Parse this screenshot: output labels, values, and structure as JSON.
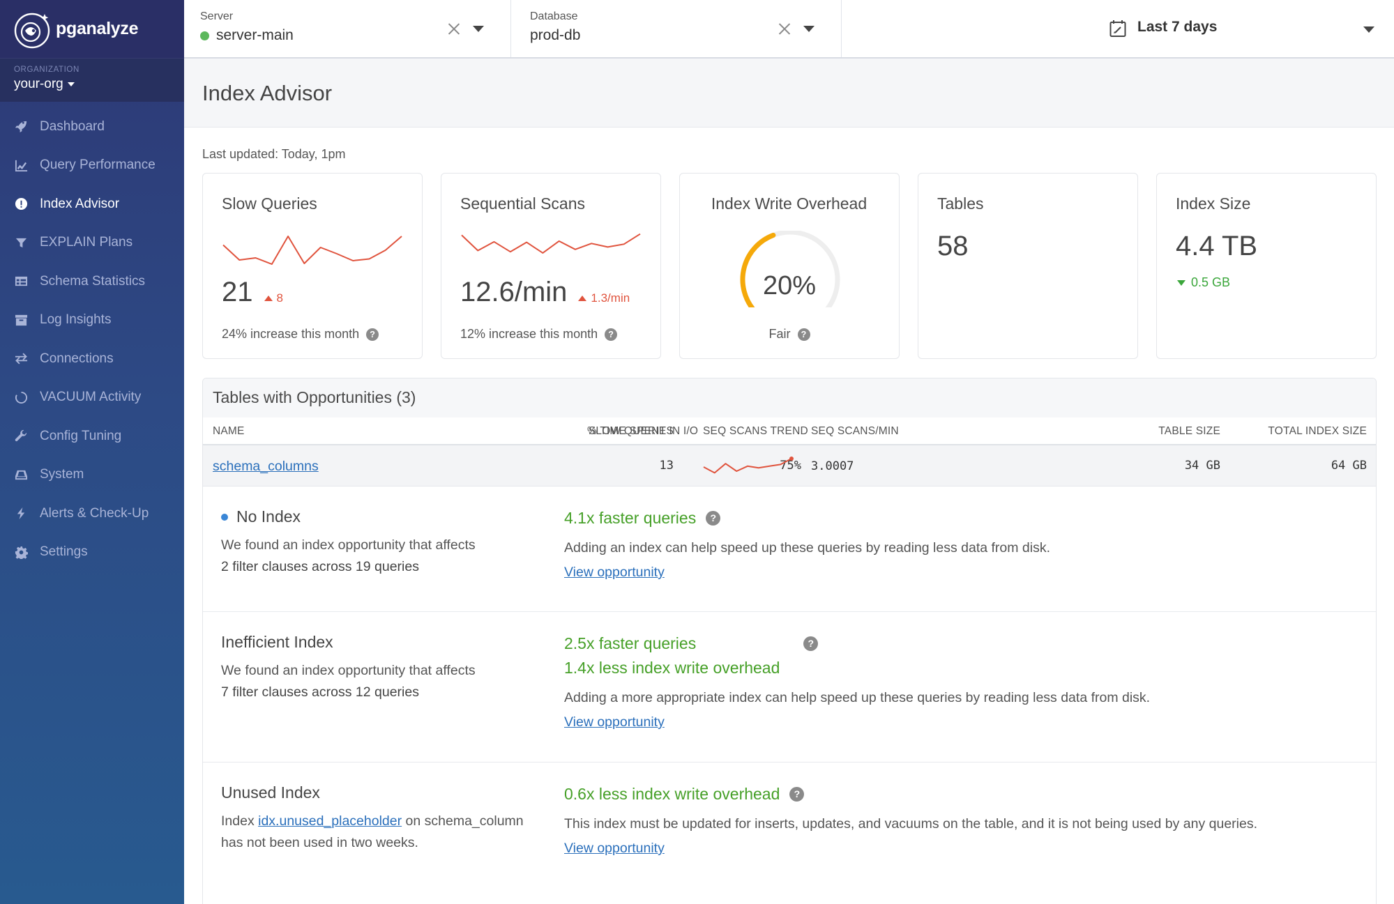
{
  "brand": {
    "name": "pganalyze"
  },
  "org": {
    "label": "ORGANIZATION",
    "name": "your-org"
  },
  "nav": [
    {
      "label": "Dashboard",
      "icon": "rocket-icon"
    },
    {
      "label": "Query Performance",
      "icon": "line-chart-icon"
    },
    {
      "label": "Index Advisor",
      "icon": "exclamation-circle-icon",
      "active": true
    },
    {
      "label": "EXPLAIN Plans",
      "icon": "filter-icon"
    },
    {
      "label": "Schema Statistics",
      "icon": "table-icon"
    },
    {
      "label": "Log Insights",
      "icon": "archive-icon"
    },
    {
      "label": "Connections",
      "icon": "exchange-icon"
    },
    {
      "label": "VACUUM Activity",
      "icon": "circle-notch-icon"
    },
    {
      "label": "Config Tuning",
      "icon": "wrench-icon"
    },
    {
      "label": "System",
      "icon": "hdd-icon"
    },
    {
      "label": "Alerts & Check-Up",
      "icon": "bolt-icon"
    },
    {
      "label": "Settings",
      "icon": "gear-icon"
    }
  ],
  "topbar": {
    "server": {
      "label": "Server",
      "value": "server-main",
      "status_color": "#5cb85c"
    },
    "database": {
      "label": "Database",
      "value": "prod-db"
    },
    "date_range": "Last 7 days"
  },
  "page": {
    "title": "Index Advisor",
    "last_updated": "Last updated: Today, 1pm"
  },
  "cards": {
    "slow_queries": {
      "title": "Slow Queries",
      "value": "21",
      "delta": "8",
      "footnote": "24% increase this month",
      "spark": [
        0.35,
        0.78,
        0.72,
        0.9,
        0.1,
        0.88,
        0.42,
        0.6,
        0.8,
        0.75,
        0.5,
        0.1
      ]
    },
    "seq_scans": {
      "title": "Sequential Scans",
      "value": "12.6/min",
      "delta": "1.3/min",
      "footnote": "12% increase this month",
      "spark": [
        0.1,
        0.75,
        0.38,
        0.8,
        0.4,
        0.85,
        0.35,
        0.7,
        0.45,
        0.6,
        0.48,
        0.05
      ]
    },
    "write_overhead": {
      "title": "Index Write Overhead",
      "value": "20%",
      "gauge_fraction": 0.2,
      "rating": "Fair",
      "gauge_color": "#f5a90a"
    },
    "tables": {
      "title": "Tables",
      "value": "58"
    },
    "index_size": {
      "title": "Index Size",
      "value": "4.4 TB",
      "delta": "0.5 GB"
    }
  },
  "opportunities": {
    "title": "Tables with Opportunities (3)",
    "columns": [
      "NAME",
      "SLOW QUERIES",
      "% TIME SPENT IN I/O",
      "SEQ SCANS TREND",
      "SEQ SCANS/MIN",
      "TABLE SIZE",
      "TOTAL INDEX SIZE"
    ],
    "row": {
      "name": "schema_columns",
      "slow_queries": "13",
      "io_pct": "75%",
      "trend": [
        0.5,
        0.85,
        0.3,
        0.75,
        0.45,
        0.55,
        0.45,
        0.35,
        0.0
      ],
      "seq_scans_min": "3.0007",
      "table_size": "34 GB",
      "total_index_size": "64 GB"
    },
    "items": [
      {
        "type": "No Index",
        "desc_line1": "We found an index opportunity that affects",
        "desc_line2": "2 filter clauses across 19 queries",
        "gain1": "4.1x faster queries",
        "text": "Adding an index can help speed up these queries by reading less data from disk.",
        "link": "View opportunity"
      },
      {
        "type": "Inefficient Index",
        "desc_line1": "We found an index opportunity that affects",
        "desc_line2": "7 filter clauses across 12 queries",
        "gain1": "2.5x faster queries",
        "gain2": "1.4x less index write overhead",
        "text": "Adding a more appropriate index can help speed up these queries by reading less data from disk.",
        "link": "View opportunity"
      },
      {
        "type": "Unused Index",
        "desc_prefix": "Index",
        "desc_index": "idx.unused_placeholder",
        "desc_suffix": "on schema_column has not been used in two weeks.",
        "gain1": "0.6x less index write overhead",
        "text": "This index must be updated for inserts, updates, and vacuums on the table, and it is not being used by any queries.",
        "link": "View opportunity"
      }
    ]
  },
  "colors": {
    "accent_green": "#46a028",
    "link_blue": "#2a6fbb",
    "alert_red": "#e0533d",
    "sidebar": "#2d3875"
  }
}
